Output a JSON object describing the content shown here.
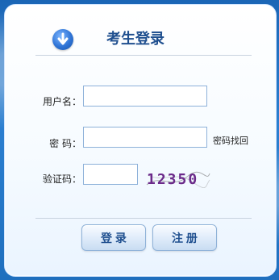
{
  "header": {
    "title": "考生登录",
    "icon": "arrow-down-circle-icon",
    "accent": "#2f74d6"
  },
  "form": {
    "username_label": "用户名：",
    "username_value": "",
    "password_label": "密  码：",
    "password_value": "",
    "forgot_password_link": "密码找回",
    "captcha_label": "验证码：",
    "captcha_value": "",
    "captcha_text": "12350"
  },
  "actions": {
    "login_label": "登 录",
    "register_label": "注 册"
  }
}
